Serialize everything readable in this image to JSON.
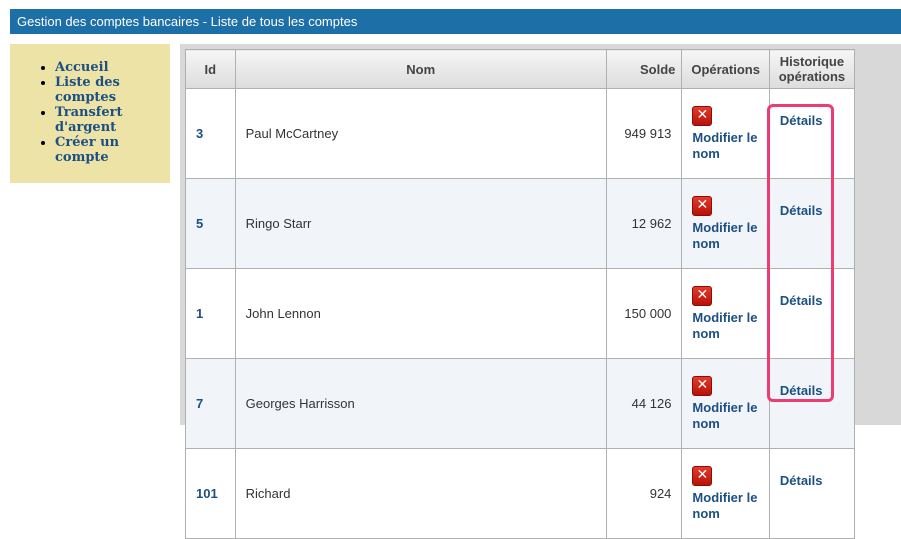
{
  "header": {
    "title": "Gestion des comptes bancaires - Liste de tous les comptes"
  },
  "sidebar": {
    "items": [
      {
        "label": "Accueil"
      },
      {
        "label": "Liste des comptes"
      },
      {
        "label": "Transfert d'argent"
      },
      {
        "label": "Créer un compte"
      }
    ]
  },
  "table": {
    "headers": {
      "id": "Id",
      "nom": "Nom",
      "solde": "Solde",
      "operations": "Opérations",
      "historique": "Historique opérations"
    },
    "delete_icon": "delete-icon",
    "rename_label": "Modifier le nom",
    "details_label": "Détails",
    "rows": [
      {
        "id": "3",
        "nom": "Paul McCartney",
        "solde": "949 913"
      },
      {
        "id": "5",
        "nom": "Ringo Starr",
        "solde": "12 962"
      },
      {
        "id": "1",
        "nom": "John Lennon",
        "solde": "150 000"
      },
      {
        "id": "7",
        "nom": "Georges Harrisson",
        "solde": "44 126"
      },
      {
        "id": "101",
        "nom": "Richard",
        "solde": "924"
      }
    ]
  },
  "colors": {
    "header_bg": "#1d6fa8",
    "sidebar_bg": "#ede3a6",
    "link": "#1c4f83",
    "highlight": "#ec3d72"
  }
}
